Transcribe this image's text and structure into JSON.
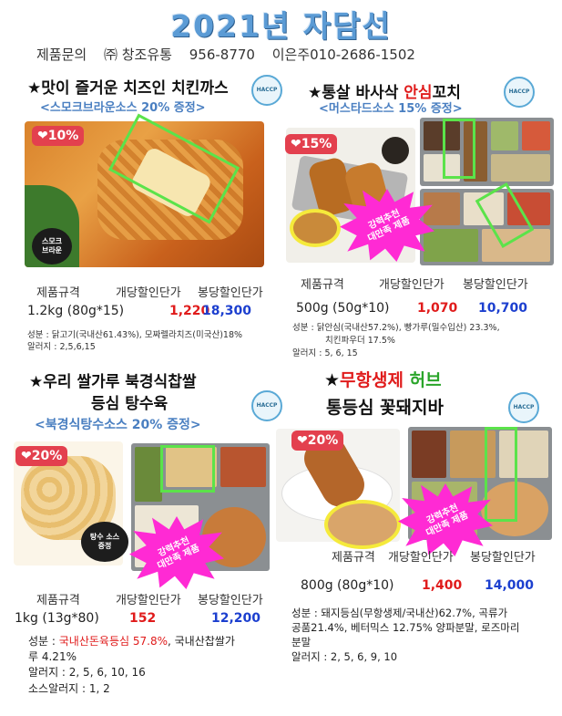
{
  "header": {
    "title": "2021년 자담선",
    "contact_label": "제품문의",
    "company": "㈜ 창조유통",
    "phone": "956-8770",
    "contact_person": "이은주010-2686-1502"
  },
  "common": {
    "spec_header": "제품규격",
    "unit_price_header": "개당할인단가",
    "box_price_header": "봉당할인단가",
    "haccp_label": "HACCP",
    "promo_burst": "강력추천\n대만족 제품"
  },
  "products": [
    {
      "title": "★맛이 즐거운 치즈인 치킨까스",
      "subtitle": "<스모크브라운소스 20% 증정>",
      "discount": "❤10%",
      "sauce_label": "스모크\n브라운",
      "spec": "1.2kg (80g*15)",
      "unit_price": "1,220",
      "box_price": "18,300",
      "ingredients": "성분 : 닭고기(국내산61.43%), 모짜렐라치즈(미국산)18%",
      "allergens": "알러지 : 2,5,6,15"
    },
    {
      "title": "★통살 바사삭 안심꼬치",
      "title_plain_1": "★통살 바사삭 ",
      "title_highlight": "안심",
      "title_plain_2": "꼬치",
      "subtitle": "<머스타드소스 15% 증정>",
      "discount": "❤15%",
      "spec": "500g (50g*10)",
      "unit_price": "1,070",
      "box_price": "10,700",
      "ingredients_1": "성분 : 닭안심(국내산57.2%), 빵가루(밀수입산) 23.3%,",
      "ingredients_2": "치킨파우더 17.5%",
      "allergens": "알러지 : 5, 6, 15"
    },
    {
      "title_line1": "★우리 쌀가루 북경식찹쌀",
      "title_line2": "등심 탕수육",
      "subtitle": "<북경식탕수소스 20% 증정>",
      "discount": "❤20%",
      "sauce_label": "탕수 소스\n증정",
      "spec": "1kg (13g*80)",
      "unit_price": "152",
      "box_price": "12,200",
      "ingredients_prefix": "성분 : ",
      "ingredients_red": "국내산돈육등심 57.8%",
      "ingredients_rest": ", 국내산찹쌀가",
      "ingredients_2": "루 4.21%",
      "allergens": "알러지 : 2, 5, 6, 10, 16",
      "sauce_allergens": "소스알러지 : 1, 2"
    },
    {
      "title_star": "★",
      "title_red": "무항생제",
      "title_green": " 허브",
      "title_line2": "통등심 꽃돼지바",
      "discount": "❤20%",
      "spec": "800g (80g*10)",
      "unit_price": "1,400",
      "box_price": "14,000",
      "ingredients_1": "성분 : 돼지등심(무항생제/국내산)62.7%, 곡류가",
      "ingredients_2": "공품21.4%, 베터믹스 12.75% 양파분말, 로즈마리",
      "ingredients_3": "분말",
      "allergens": "알러지 : 2, 5, 6, 9, 10"
    }
  ],
  "colors": {
    "title_blue": "#5b9bd5",
    "subtitle_blue": "#4a7fc1",
    "price_red": "#e01b1b",
    "price_blue": "#1c3fcf",
    "badge_red": "#e3404e",
    "highlight_green": "#5be34a",
    "burst_magenta": "#ff2ad4",
    "herb_green": "#2aa52a"
  }
}
